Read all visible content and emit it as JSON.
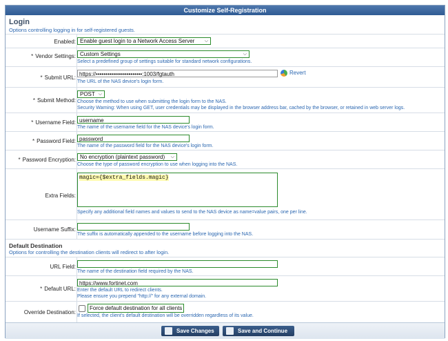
{
  "title": "Customize Self-Registration",
  "login": {
    "heading": "Login",
    "desc": "Options controlling logging in for self-registered guests."
  },
  "rows": {
    "enabled": {
      "label": "Enabled:",
      "value": "Enable guest login to a Network Access Server"
    },
    "vendor": {
      "label": "Vendor Settings:",
      "value": "Custom Settings",
      "hint": "Select a predefined group of settings suitable for standard network configurations."
    },
    "submit_url": {
      "label": "Submit URL:",
      "value": "https://••••••••••••••••••••••••:1003/fgtauth",
      "hint": "The URL of the NAS device's login form.",
      "revert": "Revert"
    },
    "submit_method": {
      "label": "Submit Method:",
      "value": "POST",
      "hint1": "Choose the method to use when submitting the login form to the NAS.",
      "hint2": "Security Warning: When using GET, user credentials may be displayed in the browser address bar, cached by the browser, or retained in web server logs."
    },
    "username_field": {
      "label": "Username Field:",
      "value": "username",
      "hint": "The name of the username field for the NAS device's login form."
    },
    "password_field": {
      "label": "Password Field:",
      "value": "password",
      "hint": "The name of the password field for the NAS device's login form."
    },
    "password_encryption": {
      "label": "Password Encryption:",
      "value": "No encryption (plaintext password)",
      "hint": "Choose the type of password encryption to use when logging into the NAS."
    },
    "extra_fields": {
      "label": "Extra Fields:",
      "value": "magic={$extra_fields.magic}",
      "hint": "Specify any additional field names and values to send to the NAS device as name=value pairs, one per line."
    },
    "username_suffix": {
      "label": "Username Suffix:",
      "value": "",
      "hint": "The suffix is automatically appended to the username before logging into the NAS."
    }
  },
  "dest": {
    "heading": "Default Destination",
    "desc": "Options for controlling the destination clients will redirect to after login.",
    "url_field": {
      "label": "URL Field:",
      "value": "",
      "hint": "The name of the destination field required by the NAS."
    },
    "default_url": {
      "label": "Default URL:",
      "value": "https://www.fortinet.com",
      "hint1": "Enter the default URL to redirect clients.",
      "hint2": "Please ensure you prepend \"http://\" for any external domain."
    },
    "override": {
      "label": "Override Destination:",
      "checkbox_label": "Force default destination for all clients",
      "hint": "If selected, the client's default destination will be overridden regardless of its value."
    }
  },
  "buttons": {
    "save": "Save Changes",
    "save_continue": "Save and Continue"
  },
  "colors": {
    "title_bar": "#3a659c",
    "field_border": "#2a8a2a",
    "hint_text": "#2a66b0",
    "highlight": "#fffbb0"
  }
}
